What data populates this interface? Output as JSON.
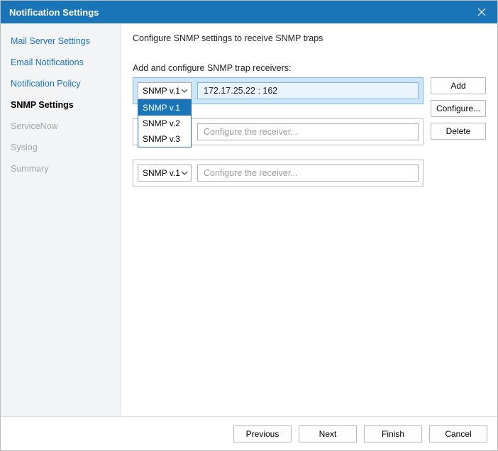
{
  "title": "Notification Settings",
  "sidebar": {
    "items": [
      {
        "label": "Mail Server Settings",
        "state": "normal"
      },
      {
        "label": "Email Notifications",
        "state": "normal"
      },
      {
        "label": "Notification Policy",
        "state": "normal"
      },
      {
        "label": "SNMP Settings",
        "state": "active"
      },
      {
        "label": "ServiceNow",
        "state": "disabled"
      },
      {
        "label": "Syslog",
        "state": "disabled"
      },
      {
        "label": "Summary",
        "state": "disabled"
      }
    ]
  },
  "main": {
    "description": "Configure SNMP settings to receive SNMP traps",
    "section_label": "Add and configure SNMP trap receivers:",
    "placeholder": "Configure the receiver...",
    "rows": [
      {
        "version": "SNMP v.1",
        "value": "172.17.25.22 : 162",
        "selected": true,
        "dropdown_open": true
      },
      {
        "version": "SNMP v.1",
        "value": "",
        "selected": false,
        "dropdown_open": false
      },
      {
        "version": "SNMP v.1",
        "value": "",
        "selected": false,
        "dropdown_open": false
      }
    ],
    "dropdown_options": [
      "SNMP v.1",
      "SNMP v.2",
      "SNMP v.3"
    ],
    "dropdown_selected_index": 0,
    "buttons": {
      "add": "Add",
      "configure": "Configure...",
      "delete": "Delete"
    }
  },
  "footer": {
    "previous": "Previous",
    "next": "Next",
    "finish": "Finish",
    "cancel": "Cancel"
  }
}
